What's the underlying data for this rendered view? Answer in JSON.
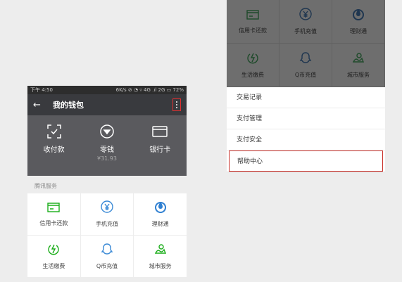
{
  "phone": {
    "status": {
      "time": "下午 4:50",
      "right": "6K/s ⊘ ◔ ▿ 4G .ıl 2G ▭ 72%"
    },
    "title": "我的钱包",
    "wallet": [
      {
        "icon": "scan-icon",
        "label": "收付款"
      },
      {
        "icon": "coin-icon",
        "label": "零钱",
        "sub": "¥31.93"
      },
      {
        "icon": "card-icon",
        "label": "银行卡"
      }
    ],
    "section_title": "腾讯服务",
    "services": [
      {
        "icon": "credit-card-icon",
        "label": "信用卡还款",
        "color": "#1aad19"
      },
      {
        "icon": "yen-icon",
        "label": "手机充值",
        "color": "#3b8ad6"
      },
      {
        "icon": "drop-icon",
        "label": "理财通",
        "color": "#2e7fd1"
      },
      {
        "icon": "lightning-icon",
        "label": "生活缴费",
        "color": "#1aad19"
      },
      {
        "icon": "qq-icon",
        "label": "Q币充值",
        "color": "#3b8ad6"
      },
      {
        "icon": "city-icon",
        "label": "城市服务",
        "color": "#1aad19"
      }
    ]
  },
  "menu": {
    "items": [
      "交易记录",
      "支付管理",
      "支付安全",
      "帮助中心"
    ]
  }
}
